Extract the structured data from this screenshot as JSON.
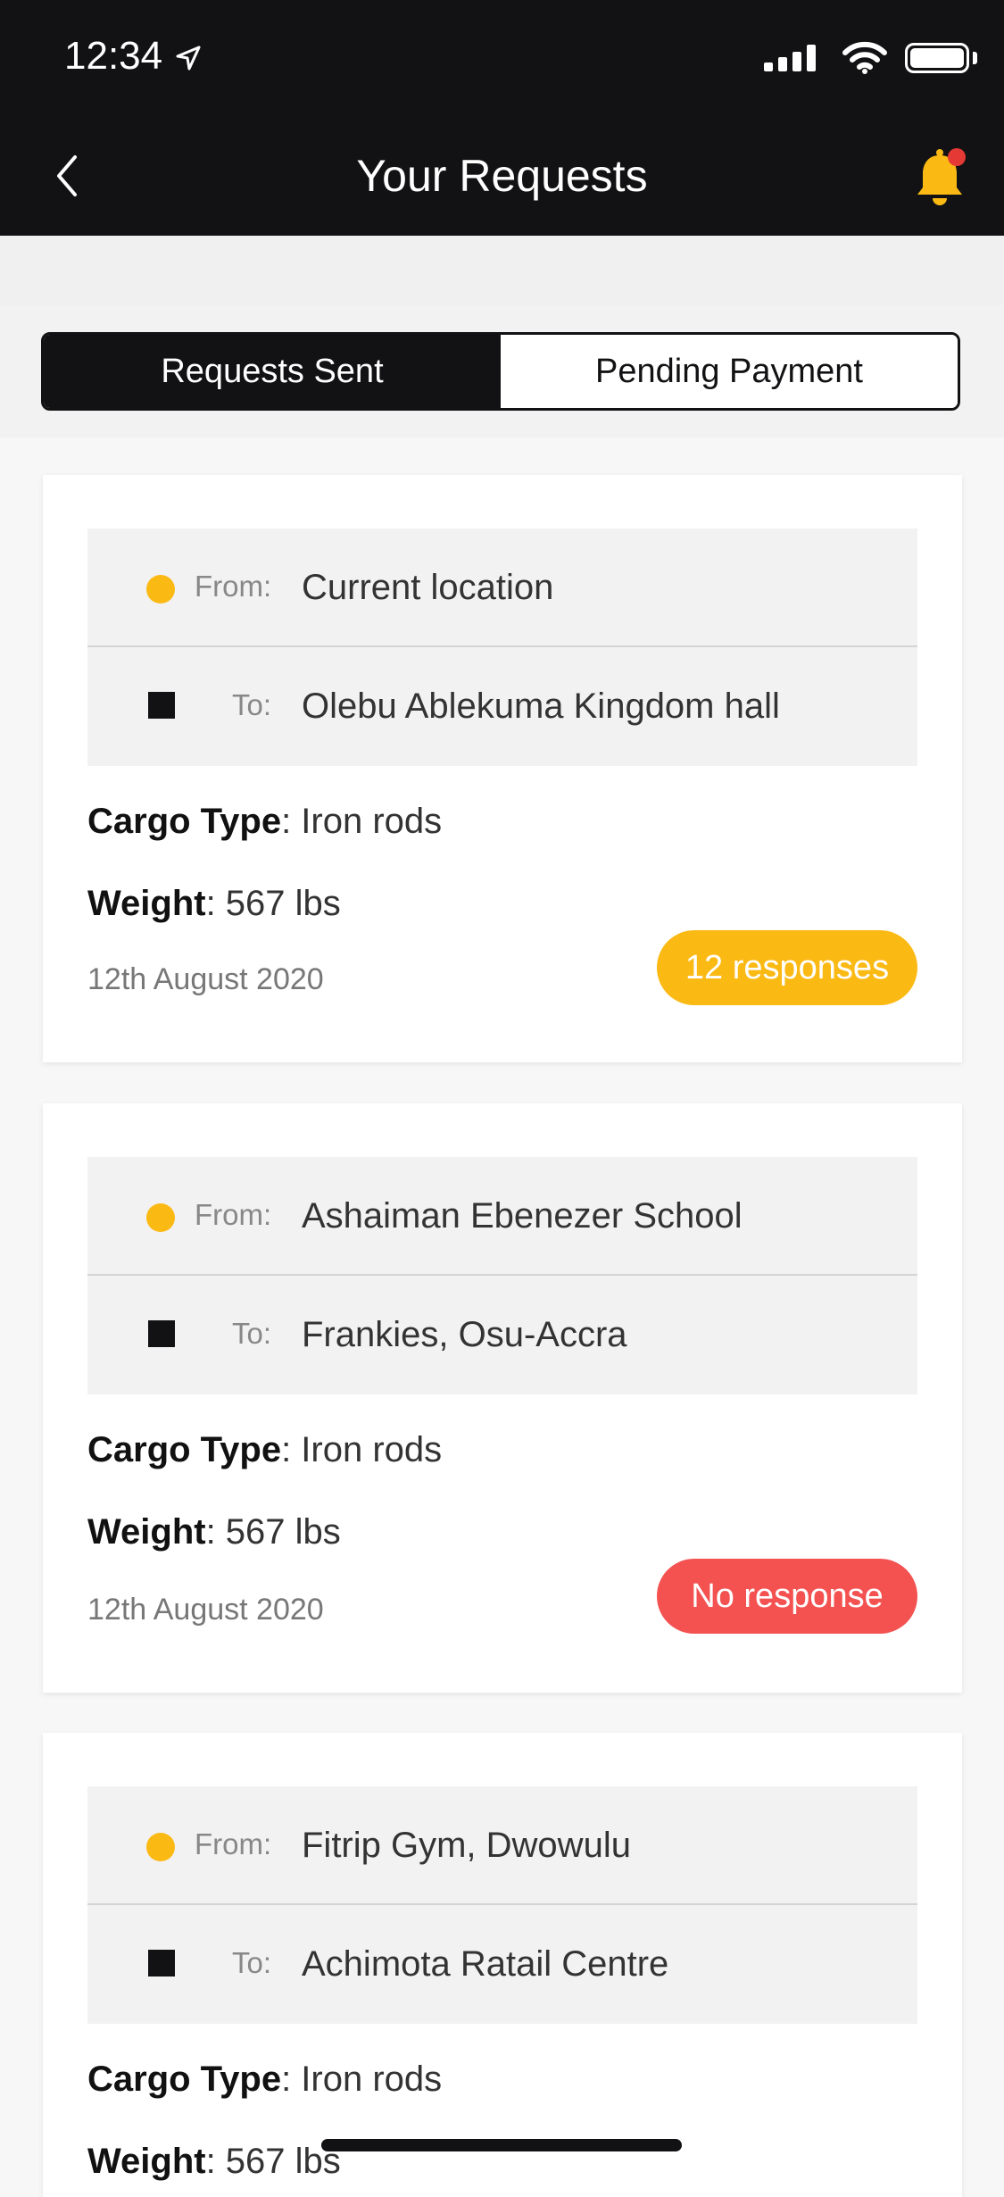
{
  "status_bar": {
    "time": "12:34"
  },
  "nav": {
    "title": "Your Requests"
  },
  "tabs": [
    {
      "label": "Requests Sent",
      "active": true
    },
    {
      "label": "Pending Payment",
      "active": false
    }
  ],
  "labels": {
    "from": "From:",
    "to": "To:",
    "cargo_type": "Cargo Type",
    "weight": "Weight"
  },
  "requests": [
    {
      "from": "Current location",
      "to": "Olebu Ablekuma Kingdom hall",
      "cargo_type": ": Iron rods",
      "weight": ": 567 lbs",
      "date": "12th August 2020",
      "status": "12 responses",
      "status_color": "#fbb914"
    },
    {
      "from": "Ashaiman Ebenezer School",
      "to": "Frankies, Osu-Accra",
      "cargo_type": ": Iron rods",
      "weight": ": 567 lbs",
      "date": "12th August 2020",
      "status": "No response",
      "status_color": "#f45151"
    },
    {
      "from": "Fitrip Gym, Dwowulu",
      "to": "Achimota Ratail Centre",
      "cargo_type": ": Iron rods",
      "weight": ": 567 lbs"
    }
  ],
  "colors": {
    "dark": "#121214",
    "accent": "#fbb914",
    "alert": "#f45151",
    "notification_dot": "#e53935"
  }
}
